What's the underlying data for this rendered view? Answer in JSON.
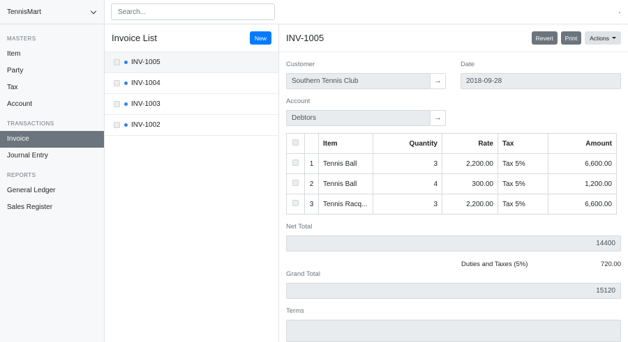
{
  "app": {
    "name": "TennisMart"
  },
  "sidebar": {
    "sections": [
      {
        "title": "MASTERS",
        "items": [
          "Item",
          "Party",
          "Tax",
          "Account"
        ]
      },
      {
        "title": "TRANSACTIONS",
        "items": [
          "Invoice",
          "Journal Entry"
        ]
      },
      {
        "title": "REPORTS",
        "items": [
          "General Ledger",
          "Sales Register"
        ]
      }
    ],
    "active_item": "Invoice"
  },
  "search": {
    "placeholder": "Search..."
  },
  "list": {
    "title": "Invoice List",
    "new_label": "New",
    "rows": [
      "INV-1005",
      "INV-1004",
      "INV-1003",
      "INV-1002"
    ],
    "status_color": "#2f80ed"
  },
  "form": {
    "title": "INV-1005",
    "buttons": {
      "revert": "Revert",
      "print": "Print",
      "actions": "Actions"
    },
    "customer": {
      "label": "Customer",
      "value": "Southern Tennis Club"
    },
    "date": {
      "label": "Date",
      "value": "2018-09-28"
    },
    "account": {
      "label": "Account",
      "value": "Debtors"
    },
    "table": {
      "headers": [
        "Item",
        "Quantity",
        "Rate",
        "Tax",
        "Amount"
      ],
      "rows": [
        {
          "idx": "1",
          "item": "Tennis Ball",
          "quantity": "3",
          "rate": "2,200.00",
          "tax": "Tax 5%",
          "amount": "6,600.00"
        },
        {
          "idx": "2",
          "item": "Tennis Ball",
          "quantity": "4",
          "rate": "300.00",
          "tax": "Tax 5%",
          "amount": "1,200.00"
        },
        {
          "idx": "3",
          "item": "Tennis Racq...",
          "quantity": "3",
          "rate": "2,200.00",
          "tax": "Tax 5%",
          "amount": "6,600.00"
        }
      ]
    },
    "net_total": {
      "label": "Net Total",
      "value": "14400"
    },
    "duties": {
      "label": "Duties and Taxes (5%)",
      "value": "720.00"
    },
    "grand_total": {
      "label": "Grand Total",
      "value": "15120"
    },
    "terms": {
      "label": "Terms",
      "value": ""
    }
  },
  "colors": {
    "primary": "#007bff",
    "secondary": "#6c757d",
    "field_bg": "#e9ecef"
  }
}
